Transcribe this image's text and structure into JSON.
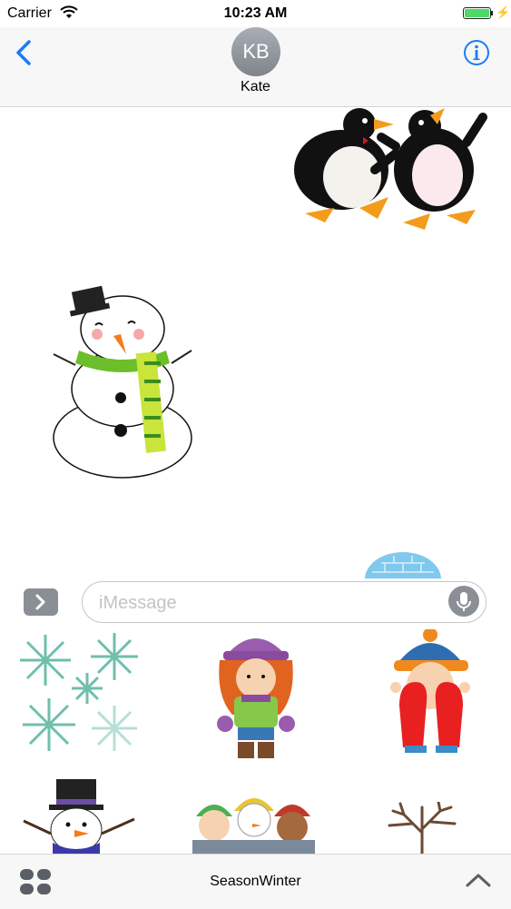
{
  "status_bar": {
    "carrier": "Carrier",
    "time": "10:23 AM",
    "battery_level": 1.0
  },
  "header": {
    "avatar_initials": "KB",
    "contact_name": "Kate"
  },
  "conversation": {
    "stickers": [
      {
        "icon": "penguins-sticker-icon"
      },
      {
        "icon": "snowman-scarf-sticker-icon"
      },
      {
        "icon": "igloo-sticker-icon"
      }
    ]
  },
  "input": {
    "placeholder": "iMessage"
  },
  "sticker_drawer": {
    "items": [
      {
        "icon": "snowflakes-sticker-icon"
      },
      {
        "icon": "girl-winter-sticker-icon"
      },
      {
        "icon": "boy-mittens-sticker-icon"
      },
      {
        "icon": "snowman-hat-sticker-icon"
      },
      {
        "icon": "kids-snowman-sticker-icon"
      },
      {
        "icon": "bare-tree-sticker-icon"
      }
    ]
  },
  "bottom_bar": {
    "app_name": "SeasonWinter"
  },
  "colors": {
    "accent": "#1a7cf5",
    "battery": "#4cd964",
    "gray_button": "#8a8f96"
  }
}
